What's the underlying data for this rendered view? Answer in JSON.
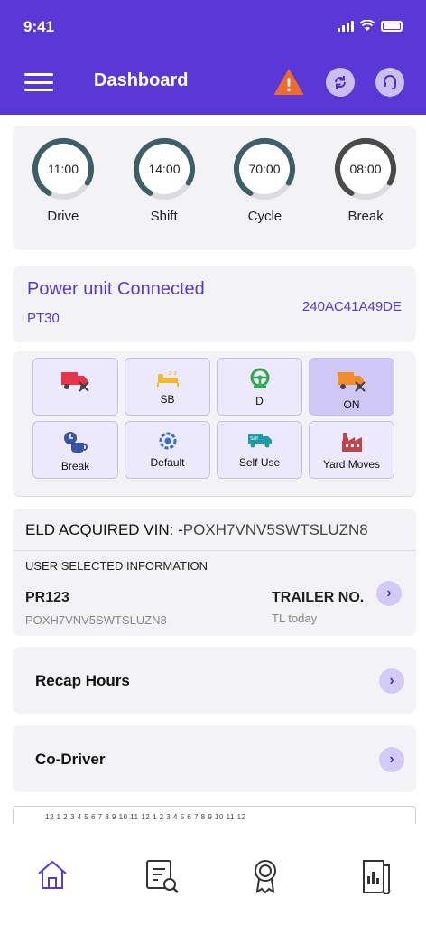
{
  "status_bar": {
    "time": "9:41"
  },
  "header": {
    "title": "Dashboard",
    "icons": [
      "menu-icon",
      "warning-icon",
      "sync-icon",
      "support-headset-icon"
    ],
    "accent_color": "#5a38d6",
    "warning_color": "#ef6a2c"
  },
  "gauges": [
    {
      "time": "11:00",
      "label": "Drive",
      "fraction": 0.75,
      "color": "#3e5f65"
    },
    {
      "time": "14:00",
      "label": "Shift",
      "fraction": 0.75,
      "color": "#3e5f65"
    },
    {
      "time": "70:00",
      "label": "Cycle",
      "fraction": 0.75,
      "color": "#3e5f65"
    },
    {
      "time": "08:00",
      "label": "Break",
      "fraction": 0.75,
      "color": "#4a4a4a"
    }
  ],
  "power_unit": {
    "title": "Power unit Connected",
    "unit": "PT30",
    "id": "240AC41A49DE"
  },
  "duty_status": [
    {
      "label": "",
      "icon": "off-duty-truck-icon",
      "active": false
    },
    {
      "label": "SB",
      "icon": "sleeper-bed-icon",
      "active": false
    },
    {
      "label": "D",
      "icon": "driving-steering-icon",
      "active": false
    },
    {
      "label": "ON",
      "icon": "on-duty-truck-icon",
      "active": true
    },
    {
      "label": "Break",
      "icon": "coffee-break-icon",
      "active": false
    },
    {
      "label": "Default",
      "icon": "default-gear-icon",
      "active": false
    },
    {
      "label": "Self Use",
      "icon": "self-use-truck-icon",
      "active": false
    },
    {
      "label": "Yard Moves",
      "icon": "yard-factory-icon",
      "active": false
    }
  ],
  "vin": {
    "prefix": "ELD ACQUIRED VIN: -",
    "value": "POXH7VNV5SWTSLUZN8",
    "section_title": "USER SELECTED INFORMATION",
    "power_unit": "PR123",
    "power_unit_vin": "POXH7VNV5SWTSLUZN8",
    "trailer_label": "TRAILER NO.",
    "trailer_value": "TL today"
  },
  "rows": {
    "recap": "Recap Hours",
    "codriver": "Co-Driver"
  },
  "graph": {
    "ticks": "12 1 2 3 4 5 6 7 8 9 10 11 12 1 2 3 4 5 6 7 8 9 10 11 12"
  },
  "bottom_nav": [
    "home-icon",
    "inspection-report-icon",
    "award-badge-icon",
    "logs-document-icon"
  ]
}
